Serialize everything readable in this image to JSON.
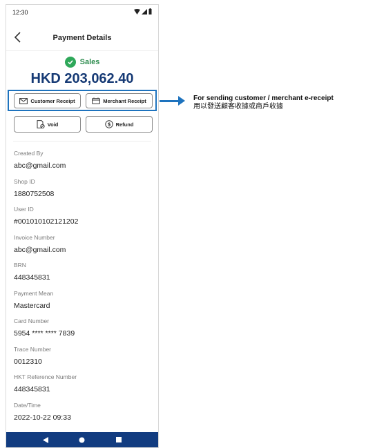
{
  "status_bar": {
    "time": "12:30"
  },
  "app_bar": {
    "title": "Payment Details"
  },
  "transaction": {
    "status": "Sales",
    "amount": "HKD 203,062.40"
  },
  "actions": {
    "customer_receipt": "Customer Receipt",
    "merchant_receipt": "Merchant Receipt",
    "void": "Void",
    "refund": "Refund"
  },
  "details": [
    {
      "label": "Created By",
      "value": "abc@gmail.com"
    },
    {
      "label": "Shop ID",
      "value": "1880752508"
    },
    {
      "label": "User ID",
      "value": "#001010102121202"
    },
    {
      "label": "Invoice Number",
      "value": "abc@gmail.com"
    },
    {
      "label": "BRN",
      "value": "448345831"
    },
    {
      "label": "Payment Mean",
      "value": "Mastercard"
    },
    {
      "label": "Card Number",
      "value": "5954 **** **** 7839"
    },
    {
      "label": "Trace Number",
      "value": "0012310"
    },
    {
      "label": "HKT Reference Number",
      "value": "448345831"
    },
    {
      "label": "Date/Time",
      "value": "2022-10-22 09:33"
    }
  ],
  "annotation": {
    "english": "For sending customer / merchant e-receipt",
    "chinese": "用以發送顧客收據或商戶收據"
  },
  "colors": {
    "accent": "#1e73be",
    "amount": "#163a75",
    "success": "#2fa85a",
    "navbar": "#123c80"
  },
  "icons": {
    "customer_receipt": "envelope-icon",
    "merchant_receipt": "merchant-envelope-icon",
    "void": "document-void-icon",
    "refund": "refund-coin-icon",
    "status": "check-circle-icon"
  }
}
